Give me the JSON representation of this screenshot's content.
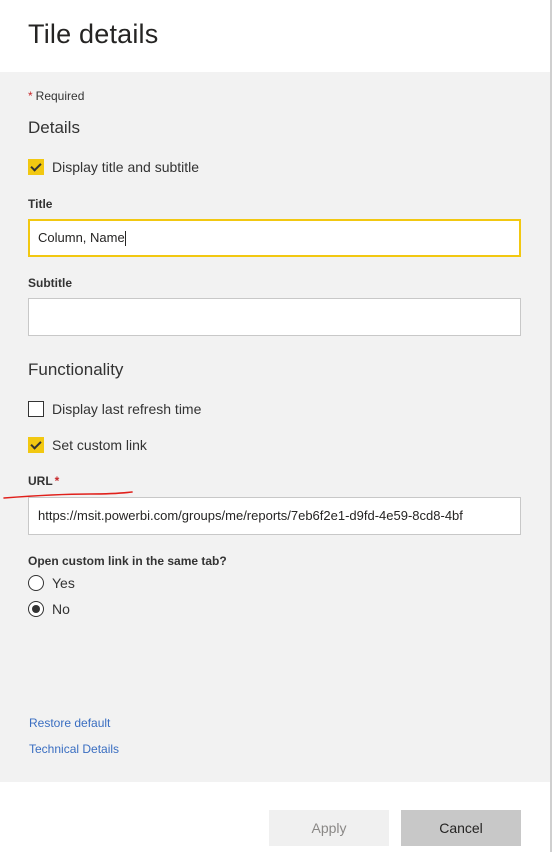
{
  "panel": {
    "title": "Tile details"
  },
  "form": {
    "required_star": "*",
    "required_text": "Required",
    "details_heading": "Details",
    "display_title_label": "Display title and subtitle",
    "display_title_checked": true,
    "title_label": "Title",
    "title_value": "Column, Name",
    "subtitle_label": "Subtitle",
    "subtitle_value": "",
    "functionality_heading": "Functionality",
    "refresh_label": "Display last refresh time",
    "refresh_checked": false,
    "custom_link_label": "Set custom link",
    "custom_link_checked": true,
    "url_label": "URL",
    "url_star": "*",
    "url_value": "https://msit.powerbi.com/groups/me/reports/7eb6f2e1-d9fd-4e59-8cd8-4bf",
    "same_tab_question": "Open custom link in the same tab?",
    "yes_label": "Yes",
    "no_label": "No",
    "same_tab_selected": "No",
    "restore_default_link": "Restore default",
    "technical_details_link": "Technical Details"
  },
  "footer": {
    "apply_label": "Apply",
    "cancel_label": "Cancel"
  },
  "colors": {
    "accent": "#f2c811",
    "required": "#c7292c",
    "link": "#3a6ec1",
    "annotation": "#e0201b"
  }
}
